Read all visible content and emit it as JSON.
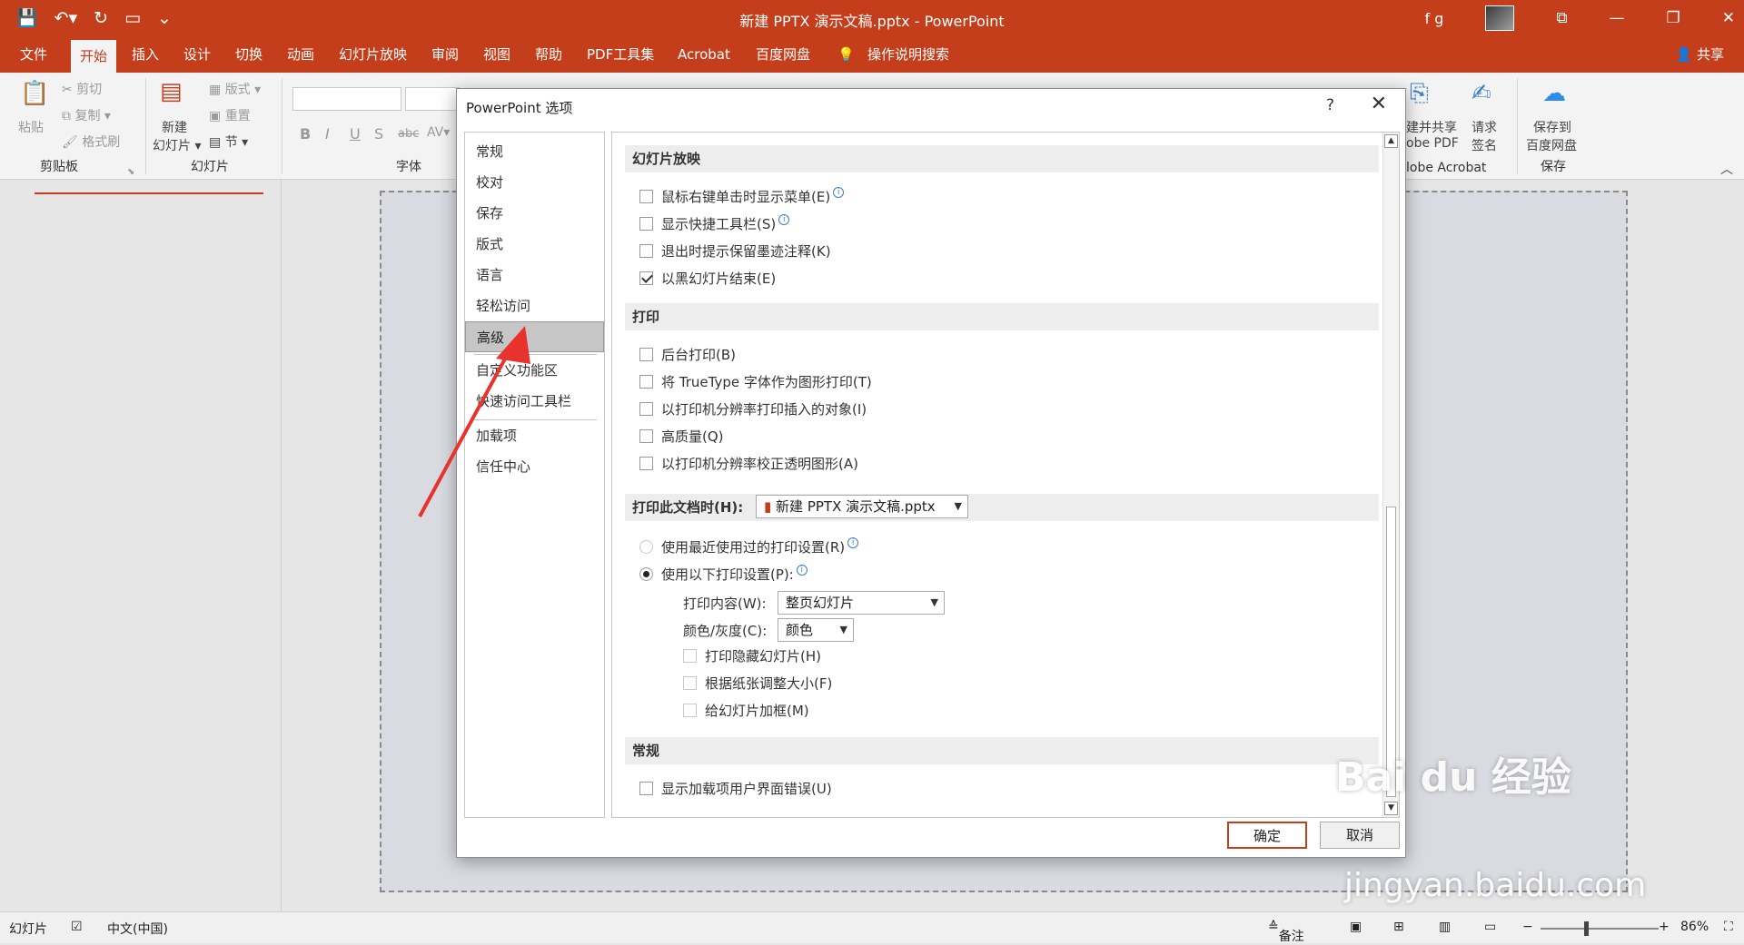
{
  "window": {
    "title": "新建 PPTX 演示文稿.pptx  -  PowerPoint",
    "user_initials": "f g",
    "share_label": "共享"
  },
  "ribbon_tabs": [
    "文件",
    "开始",
    "插入",
    "设计",
    "切换",
    "动画",
    "幻灯片放映",
    "审阅",
    "视图",
    "帮助",
    "PDF工具集",
    "Acrobat",
    "百度网盘",
    "操作说明搜索"
  ],
  "ribbon": {
    "cut": "剪切",
    "copy": "复制",
    "format_painter": "格式刷",
    "paste": "粘贴",
    "clipboard_group": "剪贴板",
    "new_slide_1": "新建",
    "new_slide_2": "幻灯片",
    "layout": "版式",
    "reset": "重置",
    "section": "节",
    "slides_group": "幻灯片",
    "font_group": "字体",
    "create_share_1": "建并共享",
    "create_share_2": "obe PDF",
    "request_sign_1": "请求",
    "request_sign_2": "签名",
    "acrobat_group": "lobe Acrobat",
    "save_to_1": "保存到",
    "save_to_2": "百度网盘",
    "save_group": "保存"
  },
  "dialog": {
    "title": "PowerPoint 选项",
    "help": "?",
    "nav": [
      "常规",
      "校对",
      "保存",
      "版式",
      "语言",
      "轻松访问",
      "高级",
      "自定义功能区",
      "快速访问工具栏",
      "加载项",
      "信任中心"
    ],
    "nav_selected": "高级",
    "sections": {
      "slideshow": {
        "header": "幻灯片放映",
        "opt1": "鼠标右键单击时显示菜单(E)",
        "opt2": "显示快捷工具栏(S)",
        "opt3": "退出时提示保留墨迹注释(K)",
        "opt4": "以黑幻灯片结束(E)"
      },
      "print": {
        "header": "打印",
        "opt1": "后台打印(B)",
        "opt2": "将 TrueType 字体作为图形打印(T)",
        "opt3": "以打印机分辨率打印插入的对象(I)",
        "opt4": "高质量(Q)",
        "opt5": "以打印机分辨率校正透明图形(A)"
      },
      "print_doc": {
        "header": "打印此文档时(H):",
        "file": "新建 PPTX 演示文稿.pptx",
        "radio1": "使用最近使用过的打印设置(R)",
        "radio2": "使用以下打印设置(P):",
        "content_label": "打印内容(W):",
        "content_value": "整页幻灯片",
        "color_label": "颜色/灰度(C):",
        "color_value": "颜色",
        "sub1": "打印隐藏幻灯片(H)",
        "sub2": "根据纸张调整大小(F)",
        "sub3": "给幻灯片加框(M)"
      },
      "general": {
        "header": "常规",
        "opt1": "显示加载项用户界面错误(U)"
      }
    },
    "ok": "确定",
    "cancel": "取消"
  },
  "status": {
    "slide": "幻灯片",
    "language": "中文(中国)",
    "notes": "备注",
    "zoom": "86%"
  },
  "watermark": {
    "brand": "Bai du 经验",
    "url": "jingyan.baidu.com"
  },
  "colors": {
    "accent": "#c43e1c"
  }
}
